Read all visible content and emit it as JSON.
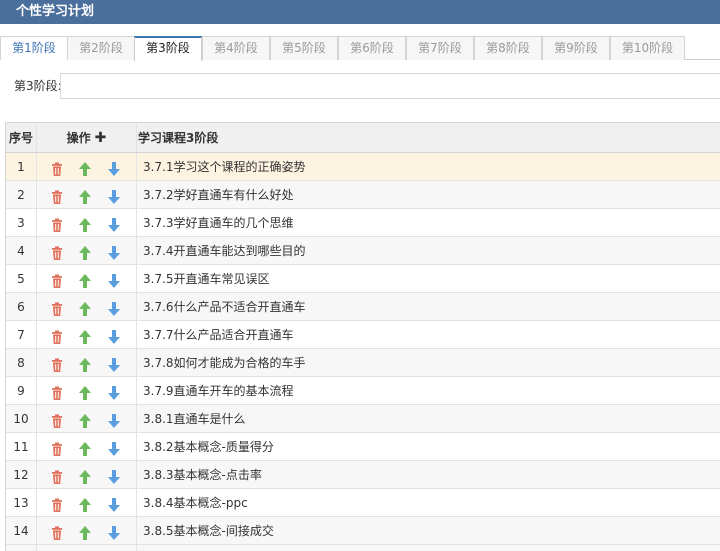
{
  "window": {
    "title": "个性学习计划"
  },
  "tabs": [
    {
      "label": "第1阶段"
    },
    {
      "label": "第2阶段"
    },
    {
      "label": "第3阶段"
    },
    {
      "label": "第4阶段"
    },
    {
      "label": "第5阶段"
    },
    {
      "label": "第6阶段"
    },
    {
      "label": "第7阶段"
    },
    {
      "label": "第8阶段"
    },
    {
      "label": "第9阶段"
    },
    {
      "label": "第10阶段"
    }
  ],
  "active_tab": "第3阶段",
  "stage_field": {
    "label": "第3阶段:",
    "value": ""
  },
  "grid": {
    "headers": {
      "index": "序号",
      "ops": "操作",
      "title": "学习课程3阶段"
    },
    "rows": [
      {
        "index": "1",
        "title": "3.7.1学习这个课程的正确姿势"
      },
      {
        "index": "2",
        "title": "3.7.2学好直通车有什么好处"
      },
      {
        "index": "3",
        "title": "3.7.3学好直通车的几个思维"
      },
      {
        "index": "4",
        "title": "3.7.4开直通车能达到哪些目的"
      },
      {
        "index": "5",
        "title": "3.7.5开直通车常见误区"
      },
      {
        "index": "6",
        "title": "3.7.6什么产品不适合开直通车"
      },
      {
        "index": "7",
        "title": "3.7.7什么产品适合开直通车"
      },
      {
        "index": "8",
        "title": "3.7.8如何才能成为合格的车手"
      },
      {
        "index": "9",
        "title": "3.7.9直通车开车的基本流程"
      },
      {
        "index": "10",
        "title": "3.8.1直通车是什么"
      },
      {
        "index": "11",
        "title": "3.8.2基本概念-质量得分"
      },
      {
        "index": "12",
        "title": "3.8.3基本概念-点击率"
      },
      {
        "index": "13",
        "title": "3.8.4基本概念-ppc"
      },
      {
        "index": "14",
        "title": "3.8.5基本概念-间接成交"
      }
    ]
  },
  "colors": {
    "titlebar": "#4b6f9c",
    "accent": "#3f74b5",
    "delete_icon": "#e0705a",
    "up_icon": "#6cb85c",
    "down_icon": "#5b9ee0",
    "selected_row": "#fdf3e1"
  },
  "icons": {
    "delete": "trash-icon",
    "up": "arrow-up-icon",
    "down": "arrow-down-icon",
    "add": "plus-icon"
  }
}
